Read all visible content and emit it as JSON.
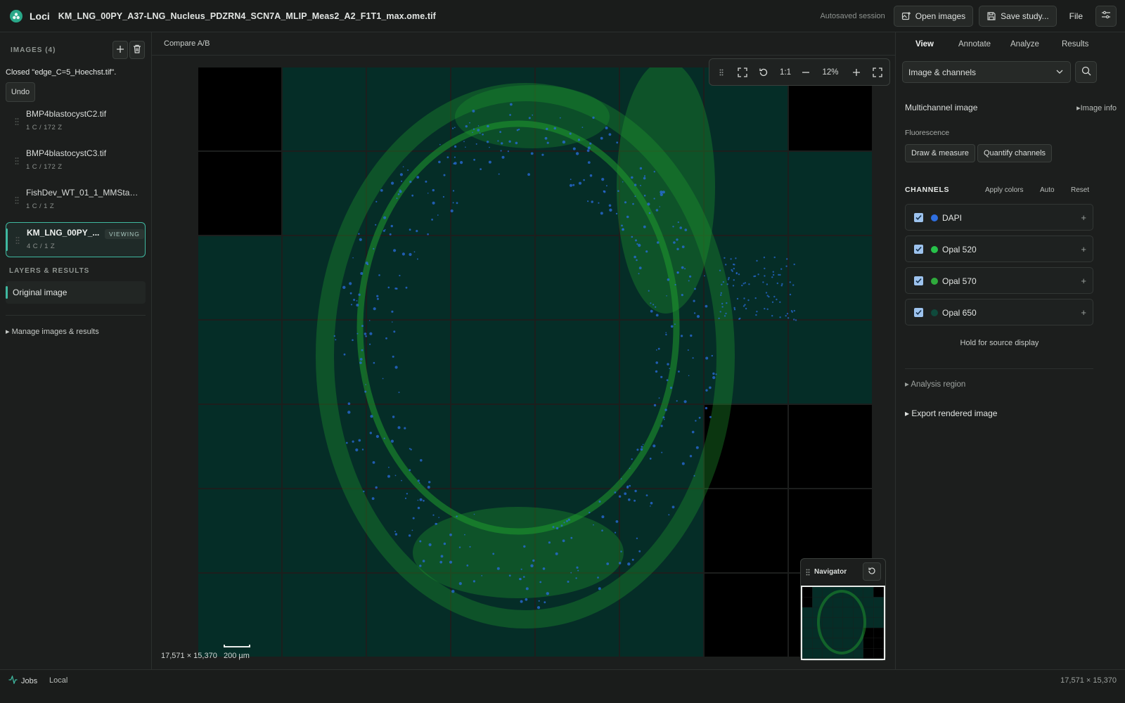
{
  "app": {
    "name": "Loci",
    "filename": "KM_LNG_00PY_A37-LNG_Nucleus_PDZRN4_SCN7A_MLIP_Meas2_A2_F1T1_max.ome.tif"
  },
  "topbar": {
    "autosave": "Autosaved session",
    "open_images": "Open images",
    "save_study": "Save study...",
    "file_menu": "File",
    "open_icon": "image-plus-icon",
    "save_icon": "floppy-disk-icon",
    "settings_icon": "sliders-icon"
  },
  "sidebar": {
    "images_header": "IMAGES (4)",
    "closed_message": "Closed \"edge_C=5_Hoechst.tif\".",
    "undo": "Undo",
    "images": [
      {
        "name": "BMP4blastocystC2.tif",
        "meta": "1 C / 172 Z"
      },
      {
        "name": "BMP4blastocystC3.tif",
        "meta": "1 C / 172 Z"
      },
      {
        "name": "FishDev_WT_01_1_MMStack...",
        "meta": "1 C / 1 Z"
      },
      {
        "name": "KM_LNG_00PY_...",
        "meta": "4 C / 1 Z",
        "badge": "VIEWING"
      }
    ],
    "layers_header": "LAYERS & RESULTS",
    "layer": "Original image",
    "manage": "Manage images & results"
  },
  "viewer": {
    "compare": "Compare A/B",
    "toolbar": {
      "one_to_one": "1:1",
      "zoom": "12%"
    },
    "dimensions": "17,571 × 15,370",
    "scale_label": "200 µm",
    "navigator": "Navigator",
    "tile_grid": {
      "cols": 8,
      "rows": 7
    },
    "empty_tiles": [
      [
        0,
        0
      ],
      [
        7,
        0
      ],
      [
        0,
        1
      ],
      [
        6,
        4
      ],
      [
        7,
        4
      ],
      [
        6,
        5
      ],
      [
        7,
        5
      ],
      [
        6,
        6
      ],
      [
        7,
        6
      ]
    ],
    "colors": {
      "tile": "#052d27",
      "empty": "#000000",
      "tissue": "#1f9a2e",
      "nuclei": "#2a6ee0"
    }
  },
  "right_panel": {
    "tabs": [
      "View",
      "Annotate",
      "Analyze",
      "Results"
    ],
    "active_tab": "View",
    "select_value": "Image & channels",
    "multichannel": "Multichannel image",
    "image_info": "Image info",
    "fluorescence": "Fluorescence",
    "draw_measure": "Draw & measure",
    "quantify": "Quantify channels",
    "channels_header": "CHANNELS",
    "apply_colors": "Apply colors",
    "auto": "Auto",
    "reset": "Reset",
    "channels": [
      {
        "name": "DAPI",
        "color": "#2f6fe0",
        "checked": true
      },
      {
        "name": "Opal 520",
        "color": "#27c24a",
        "checked": true
      },
      {
        "name": "Opal 570",
        "color": "#2faa3c",
        "checked": true
      },
      {
        "name": "Opal 650",
        "color": "#0f4a3c",
        "checked": true
      }
    ],
    "hold": "Hold for source display",
    "analysis_region": "Analysis region",
    "export": "Export rendered image"
  },
  "statusbar": {
    "jobs": "Jobs",
    "local": "Local",
    "dims": "17,571 × 15,370"
  }
}
